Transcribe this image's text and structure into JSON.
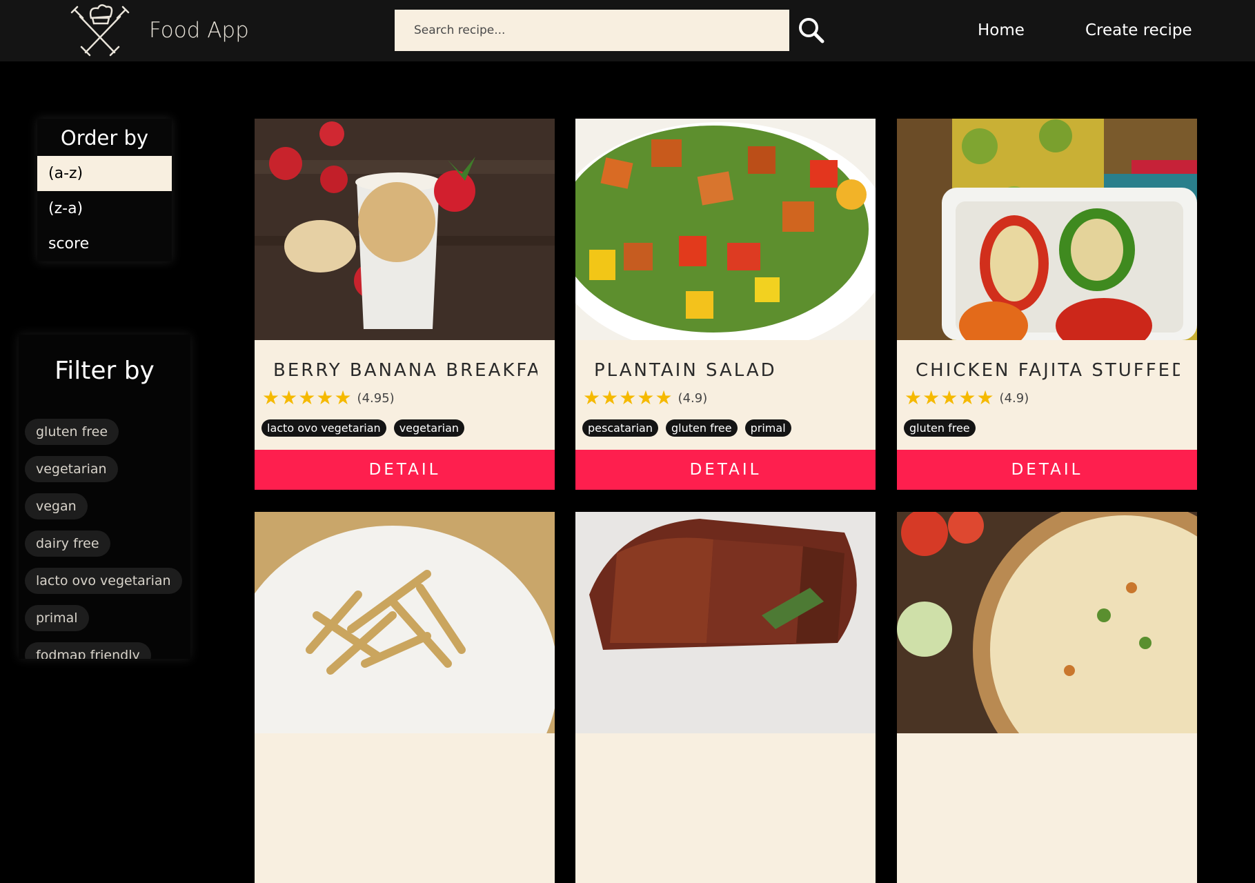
{
  "app": {
    "title": "Food App",
    "logo_icon": "chef-knives-logo-icon",
    "search_placeholder": "Search recipe...",
    "search_icon": "search-icon",
    "nav": [
      {
        "label": "Home"
      },
      {
        "label": "Create recipe"
      }
    ]
  },
  "order": {
    "title": "Order by",
    "options": [
      {
        "label": "(a-z)",
        "selected": true
      },
      {
        "label": "(z-a)",
        "selected": false
      },
      {
        "label": "score",
        "selected": false
      }
    ]
  },
  "filter": {
    "title": "Filter by",
    "chips": [
      {
        "label": "gluten free"
      },
      {
        "label": "vegetarian"
      },
      {
        "label": "vegan"
      },
      {
        "label": "dairy free"
      },
      {
        "label": "lacto ovo vegetarian"
      },
      {
        "label": "primal"
      },
      {
        "label": "fodmap friendly"
      }
    ]
  },
  "recipes": [
    {
      "title": "BERRY BANANA BREAKFAST SMOOTHIE",
      "stars": 5,
      "score": "(4.95)",
      "tags": [
        "lacto ovo vegetarian",
        "vegetarian"
      ],
      "detail": "DETAIL",
      "image": "smoothie-photo"
    },
    {
      "title": "PLANTAIN SALAD",
      "stars": 5,
      "score": "(4.9)",
      "tags": [
        "pescatarian",
        "gluten free",
        "primal"
      ],
      "detail": "DETAIL",
      "image": "salad-photo"
    },
    {
      "title": "CHICKEN FAJITA STUFFED BELL PEPPER",
      "stars": 5,
      "score": "(4.9)",
      "tags": [
        "gluten free"
      ],
      "detail": "DETAIL",
      "image": "stuffed-peppers-photo"
    },
    {
      "image": "fries-photo"
    },
    {
      "image": "bacon-meat-photo"
    },
    {
      "image": "pizza-photo"
    }
  ],
  "colors": {
    "topbar": "#141414",
    "background": "#000000",
    "cream": "#f8efe0",
    "accent": "#fe1f4e",
    "star": "#f5b900"
  }
}
